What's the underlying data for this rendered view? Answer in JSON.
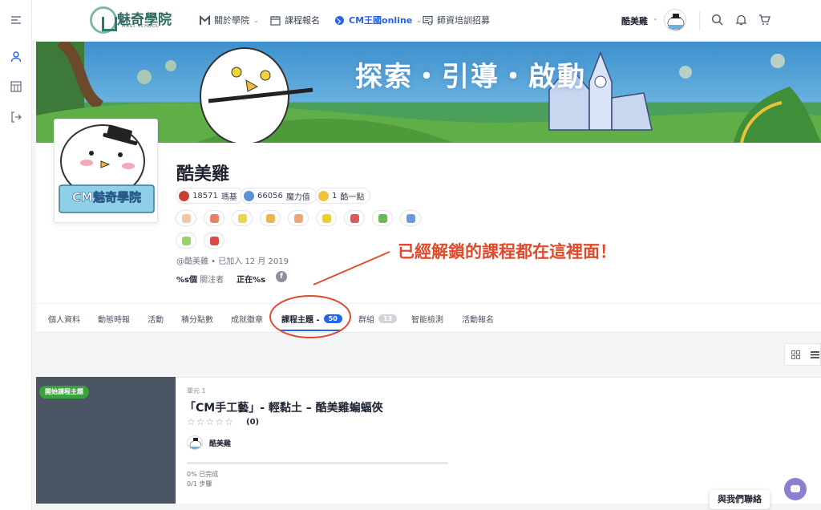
{
  "header": {
    "logo": {
      "name": "魅奇學院",
      "subtitle": "MAGI SCHOOL"
    },
    "nav": [
      {
        "label": "關於學院",
        "icon": "m-logo-icon",
        "dropdown": true
      },
      {
        "label": "課程報名",
        "icon": "calendar-icon",
        "dropdown": false
      },
      {
        "label": "CM王國online",
        "icon": "globe-icon",
        "dropdown": true,
        "active": true
      },
      {
        "label": "師資培訓招募",
        "icon": "certificate-icon",
        "dropdown": false
      }
    ],
    "user_name": "酷美雞"
  },
  "banner": {
    "title": "探索・引導・啟動"
  },
  "profile": {
    "name": "酷美雞",
    "avatar_caption": "CM魅奇學院",
    "points": [
      {
        "value": "18571",
        "unit": "瑪基",
        "color": "#c8402f"
      },
      {
        "value": "66056",
        "unit": "魔力值",
        "color": "#5b8fd6"
      },
      {
        "value": "1",
        "unit": "酷一點",
        "color": "#f2c23a"
      }
    ],
    "badge_colors": [
      "#f0c8a8",
      "#e8806a",
      "#e8d84a",
      "#e8b84a",
      "#e8a87a",
      "#e8d030",
      "#d85a5a",
      "#6ab85a",
      "#6a9ad8",
      "#9ad06a",
      "#d84a4a"
    ],
    "handle": "@酷美雞",
    "joined": "已加入 12 月 2019",
    "followers_value": "%s個",
    "followers_label": "關注者",
    "following_label": "正在%s"
  },
  "annotation": "已經解鎖的課程都在這裡面！",
  "tabs": [
    {
      "label": "個人資料"
    },
    {
      "label": "動態時報"
    },
    {
      "label": "活動"
    },
    {
      "label": "積分點數"
    },
    {
      "label": "成就徽章"
    },
    {
      "label": "課程主題 -",
      "count": "50",
      "active": true
    },
    {
      "label": "群組",
      "count": "13"
    },
    {
      "label": "智能檢測"
    },
    {
      "label": "活動報名"
    }
  ],
  "course": {
    "badge": "開始課程主題",
    "unit": "單元 1",
    "title": "「CM手工藝」- 輕黏土 – 酷美雞蝙蝠俠",
    "stars": "☆☆☆☆☆",
    "rating": "(0)",
    "author": "酷美雞",
    "progress": 0,
    "completed": "0% 已完成",
    "steps": "0/1 步驟"
  },
  "contact_label": "與我們聯絡"
}
